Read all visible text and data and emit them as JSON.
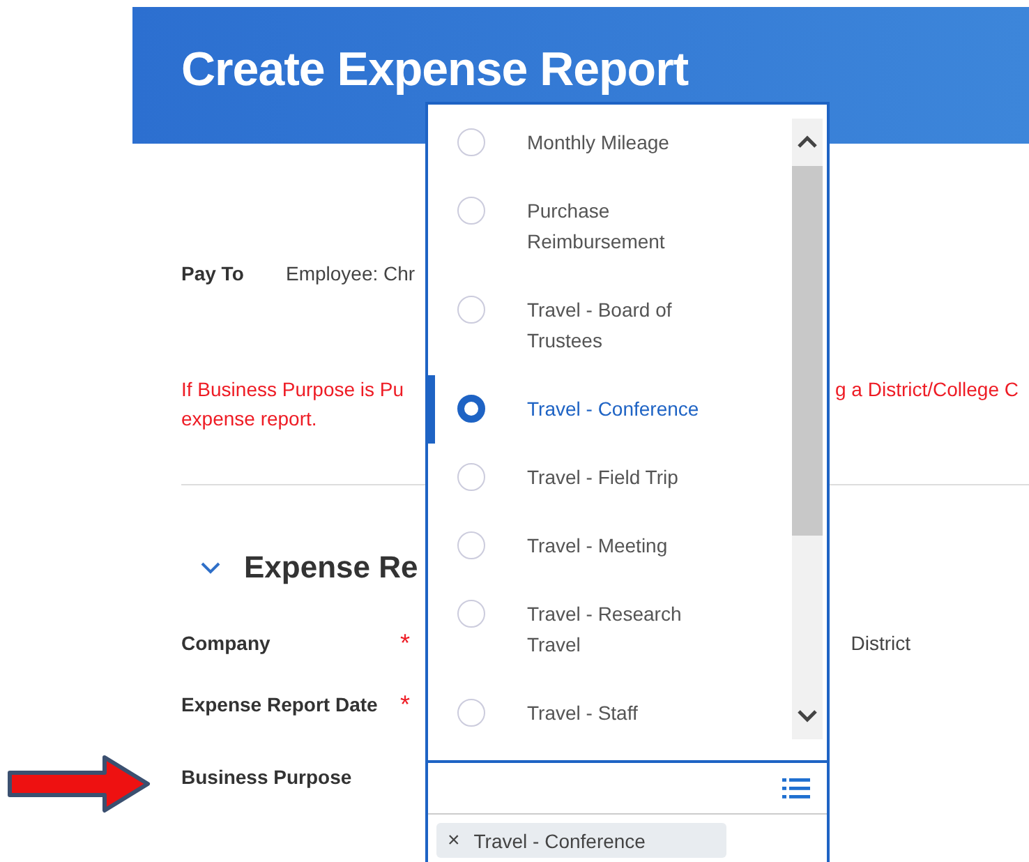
{
  "header": {
    "title": "Create Expense Report"
  },
  "pay_to": {
    "label": "Pay To",
    "value": "Employee: Chr"
  },
  "notice": {
    "line_1_left": "If Business Purpose is Pu",
    "line_1_right": "g a District/College C",
    "line_2": "expense report."
  },
  "section": {
    "title": "Expense Re",
    "expanded": true
  },
  "fields": [
    {
      "label": "Company",
      "required_marker": "*",
      "value": "District"
    },
    {
      "label": "Expense Report Date",
      "required_marker": "*"
    },
    {
      "label": "Business Purpose"
    }
  ],
  "dropdown": {
    "options": [
      {
        "label": "Monthly Mileage",
        "selected": false
      },
      {
        "label": "Purchase Reimbursement",
        "selected": false
      },
      {
        "label": "Travel - Board of Trustees",
        "selected": false
      },
      {
        "label": "Travel - Conference",
        "selected": true
      },
      {
        "label": "Travel - Field Trip",
        "selected": false
      },
      {
        "label": "Travel - Meeting",
        "selected": false
      },
      {
        "label": "Travel - Research Travel",
        "selected": false
      },
      {
        "label": "Travel - Staff",
        "selected": false
      }
    ]
  },
  "business_purpose_field": {
    "selected_items": [
      {
        "remove_glyph": "×",
        "label": "Travel - Conference"
      }
    ]
  }
}
